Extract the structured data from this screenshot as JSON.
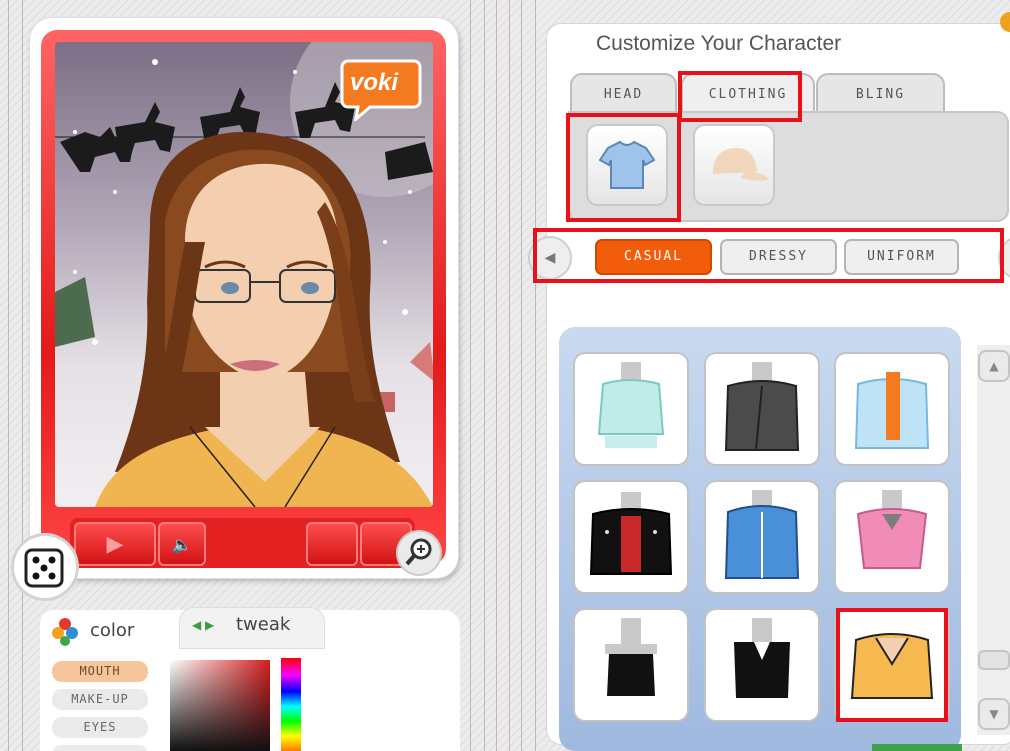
{
  "app": {
    "logo_text": "voki"
  },
  "right": {
    "title": "Customize Your Character",
    "tabs": [
      {
        "label": "HEAD"
      },
      {
        "label": "CLOTHING"
      },
      {
        "label": "BLING"
      }
    ],
    "categories": [
      {
        "label": "CASUAL"
      },
      {
        "label": "DRESSY"
      },
      {
        "label": "UNIFORM"
      }
    ],
    "selected_tab": "CLOTHING",
    "selected_category": "CASUAL",
    "item_icons": [
      "shirt-icon",
      "cap-icon"
    ],
    "clothing_items": [
      "mint-wrap-top",
      "gray-blazer",
      "light-blue-jacket",
      "black-leather-jacket",
      "blue-track-jacket",
      "pink-top",
      "black-tank-top",
      "black-vest-top",
      "yellow-v-neck-top"
    ],
    "selected_item": "yellow-v-neck-top"
  },
  "left": {
    "tabs": [
      {
        "label": "color"
      },
      {
        "label": "tweak"
      }
    ],
    "color_targets": [
      {
        "label": "MOUTH"
      },
      {
        "label": "MAKE-UP"
      },
      {
        "label": "EYES"
      }
    ],
    "selected_target": "MOUTH"
  },
  "colors": {
    "card_red": "#e31a1a",
    "accent_orange": "#f25d0c",
    "highlight": "#e8101a",
    "grid_blue": "#b5cbe8"
  }
}
